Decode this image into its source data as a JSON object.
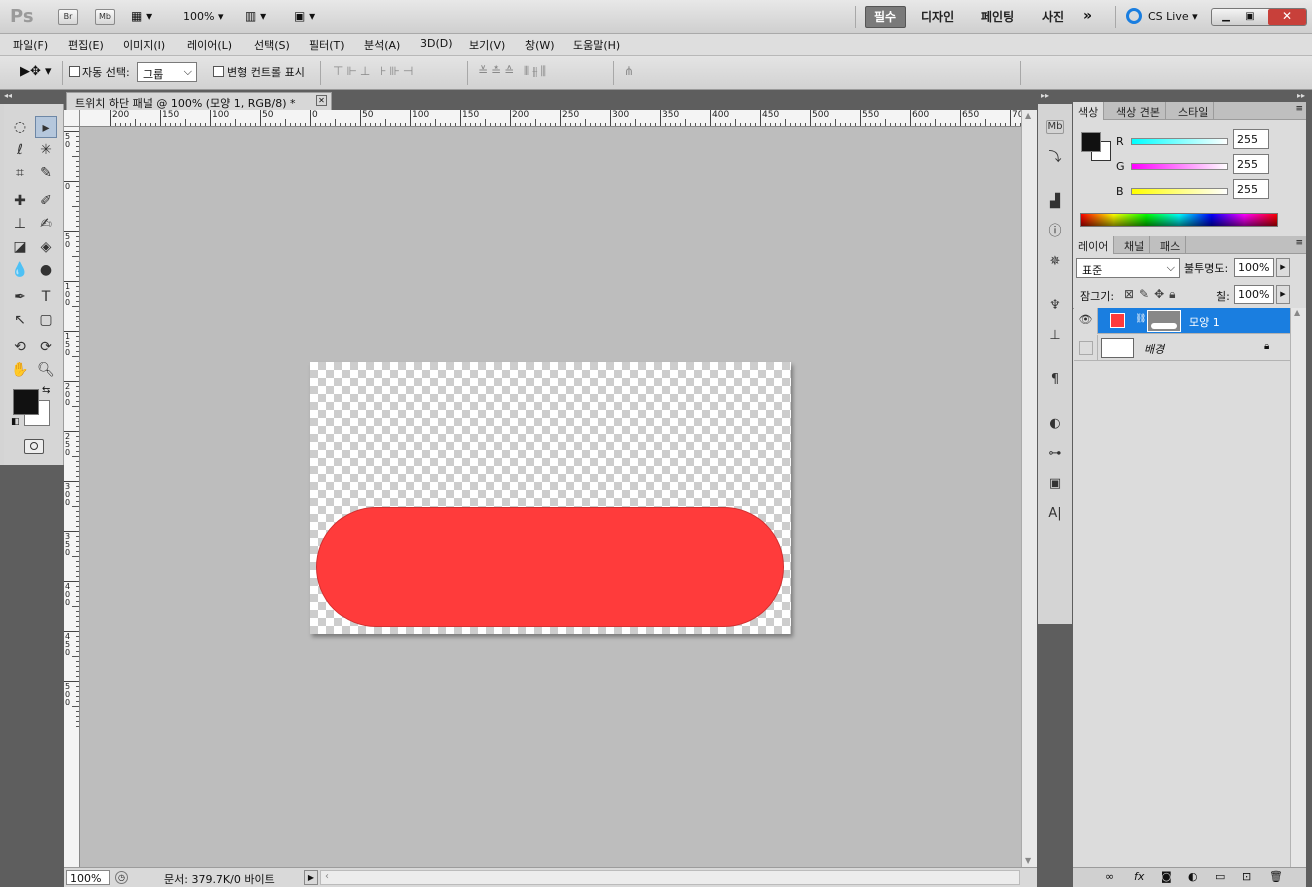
{
  "app": {
    "logo": "Ps",
    "zoom": "100%",
    "bridge": "Br",
    "minibridge": "Mb"
  },
  "workspaces": [
    "필수",
    "디자인",
    "페인팅",
    "사진"
  ],
  "cslive": "CS Live",
  "menu": [
    "파일(F)",
    "편집(E)",
    "이미지(I)",
    "레이어(L)",
    "선택(S)",
    "필터(T)",
    "분석(A)",
    "3D(D)",
    "보기(V)",
    "창(W)",
    "도움말(H)"
  ],
  "options": {
    "auto_select_label": "자동 선택:",
    "auto_select_value": "그룹",
    "transform_label": "변형 컨트롤 표시"
  },
  "document": {
    "tab_title": "트위치 하단 패널 @ 100% (모양 1, RGB/8) *",
    "status_zoom": "100%",
    "status_info": "문서: 379.7K/0 바이트",
    "shape_color": "#ff3b3b",
    "hruler_labels": [
      "200",
      "150",
      "100",
      "50",
      "0",
      "50",
      "100",
      "150",
      "200",
      "250",
      "300",
      "350",
      "400",
      "450",
      "500",
      "550",
      "600",
      "650",
      "70"
    ],
    "vruler_labels": [
      "50",
      "0",
      "50",
      "100",
      "150",
      "200",
      "250",
      "300",
      "350",
      "400",
      "450",
      "500"
    ]
  },
  "color_panel": {
    "tabs": [
      "색상",
      "색상 견본",
      "스타일"
    ],
    "channels": [
      {
        "label": "R",
        "value": "255",
        "color": "#00e5e5"
      },
      {
        "label": "G",
        "value": "255",
        "color": "#e500e5"
      },
      {
        "label": "B",
        "value": "255",
        "color": "#e5e500"
      }
    ]
  },
  "layers_panel": {
    "tabs": [
      "레이어",
      "채널",
      "패스"
    ],
    "blend_mode": "표준",
    "opacity_label": "불투명도:",
    "opacity": "100%",
    "lock_label": "잠그기:",
    "fill_label": "칠:",
    "fill": "100%",
    "layers": [
      {
        "name": "모양 1",
        "selected": true,
        "swatch": "#ff3b3b"
      },
      {
        "name": "배경",
        "selected": false,
        "locked": true
      }
    ]
  },
  "colors": {
    "foreground": "#111111",
    "background": "#ffffff",
    "accent": "#1a7ee0"
  }
}
